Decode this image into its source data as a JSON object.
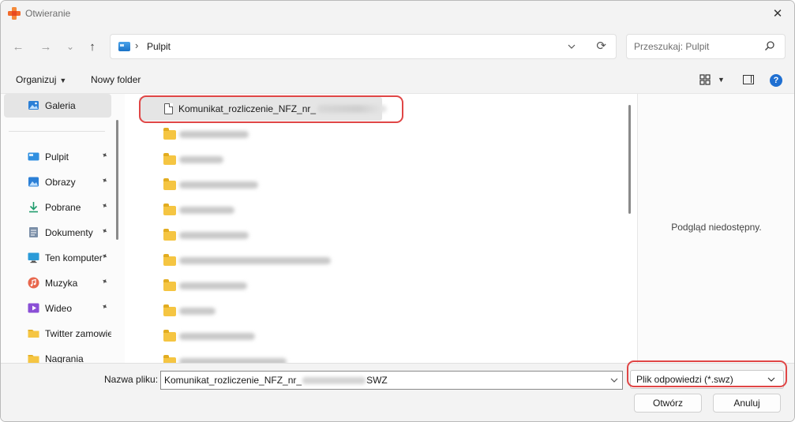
{
  "window": {
    "title": "Otwieranie",
    "close_glyph": "✕"
  },
  "nav": {
    "back_glyph": "←",
    "forward_glyph": "→",
    "recent_glyph": "⌄",
    "up_glyph": "↑",
    "address_separator": "›",
    "address": "Pulpit",
    "refresh_glyph": "⟳",
    "search_placeholder": "Przeszukaj: Pulpit"
  },
  "commandbar": {
    "organize_label": "Organizuj",
    "new_folder_label": "Nowy folder",
    "help_glyph": "?"
  },
  "sidebar": {
    "gallery_label": "Galeria",
    "items": [
      {
        "label": "Pulpit",
        "icon": "desktop-icon",
        "pinned": true
      },
      {
        "label": "Obrazy",
        "icon": "pictures-icon",
        "pinned": true
      },
      {
        "label": "Pobrane",
        "icon": "download-icon",
        "pinned": true
      },
      {
        "label": "Dokumenty",
        "icon": "documents-icon",
        "pinned": true
      },
      {
        "label": "Ten komputer",
        "icon": "computer-icon",
        "pinned": true
      },
      {
        "label": "Muzyka",
        "icon": "music-icon",
        "pinned": true
      },
      {
        "label": "Wideo",
        "icon": "video-icon",
        "pinned": true
      },
      {
        "label": "Twitter zamowienia",
        "icon": "folder-icon",
        "pinned": false
      },
      {
        "label": "Nagrania",
        "icon": "folder-icon",
        "pinned": false
      }
    ],
    "pin_glyph": "📌"
  },
  "files": {
    "selected_file_label": "Komunikat_rozliczenie_NFZ_nr_",
    "folder_count": 10
  },
  "preview": {
    "text": "Podgląd niedostępny."
  },
  "bottom": {
    "filename_label": "Nazwa pliku:",
    "filename_prefix": "Komunikat_rozliczenie_NFZ_nr_",
    "filename_suffix": "SWZ",
    "filetype": "Plik odpowiedzi (*.swz)",
    "open_button": "Otwórz",
    "cancel_button": "Anuluj"
  },
  "colors": {
    "highlight": "#e04646",
    "accent": "#1f6fd1",
    "folder": "#f5c542"
  }
}
